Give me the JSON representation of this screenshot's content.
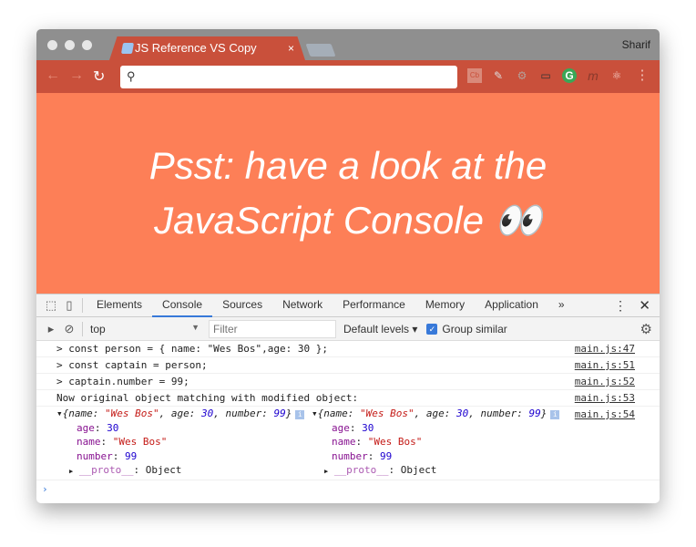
{
  "browser": {
    "tab_title": "JS Reference VS Copy",
    "tab_close": "×",
    "user": "Sharif",
    "extensions": [
      "Cb",
      "✎",
      "⚙",
      "▭",
      "G",
      "m",
      "⚛",
      "⋮"
    ]
  },
  "page": {
    "line1": "Psst: have a look at the",
    "line2": "JavaScript Console 👀"
  },
  "devtools": {
    "tabs": [
      "Elements",
      "Console",
      "Sources",
      "Network",
      "Performance",
      "Memory",
      "Application",
      "»"
    ],
    "active_tab": "Console"
  },
  "console_toolbar": {
    "context": "top",
    "filter_placeholder": "Filter",
    "levels": "Default levels ▾",
    "group_similar": "Group similar"
  },
  "logs": [
    {
      "text": "> const person = { name: \"Wes Bos\",age: 30 };",
      "source": "main.js:47"
    },
    {
      "text": "> const captain = person;",
      "source": "main.js:51"
    },
    {
      "text": "> captain.number = 99;",
      "source": "main.js:52"
    },
    {
      "text": "Now original object matching with modified object:",
      "source": "main.js:53"
    }
  ],
  "object_log": {
    "source": "main.js:54",
    "summary_open": "▾{",
    "k_name": "name: ",
    "v_name": "\"Wes Bos\"",
    "k_age": ", age: ",
    "v_age": "30",
    "k_number": ", number: ",
    "v_number": "99",
    "summary_close": "}",
    "props": [
      {
        "key": "age",
        "value": "30"
      },
      {
        "key": "name",
        "value": "\"Wes Bos\""
      },
      {
        "key": "number",
        "value": "99"
      }
    ],
    "proto_key": "__proto__",
    "proto_value": ": Object"
  },
  "prompt": "›"
}
